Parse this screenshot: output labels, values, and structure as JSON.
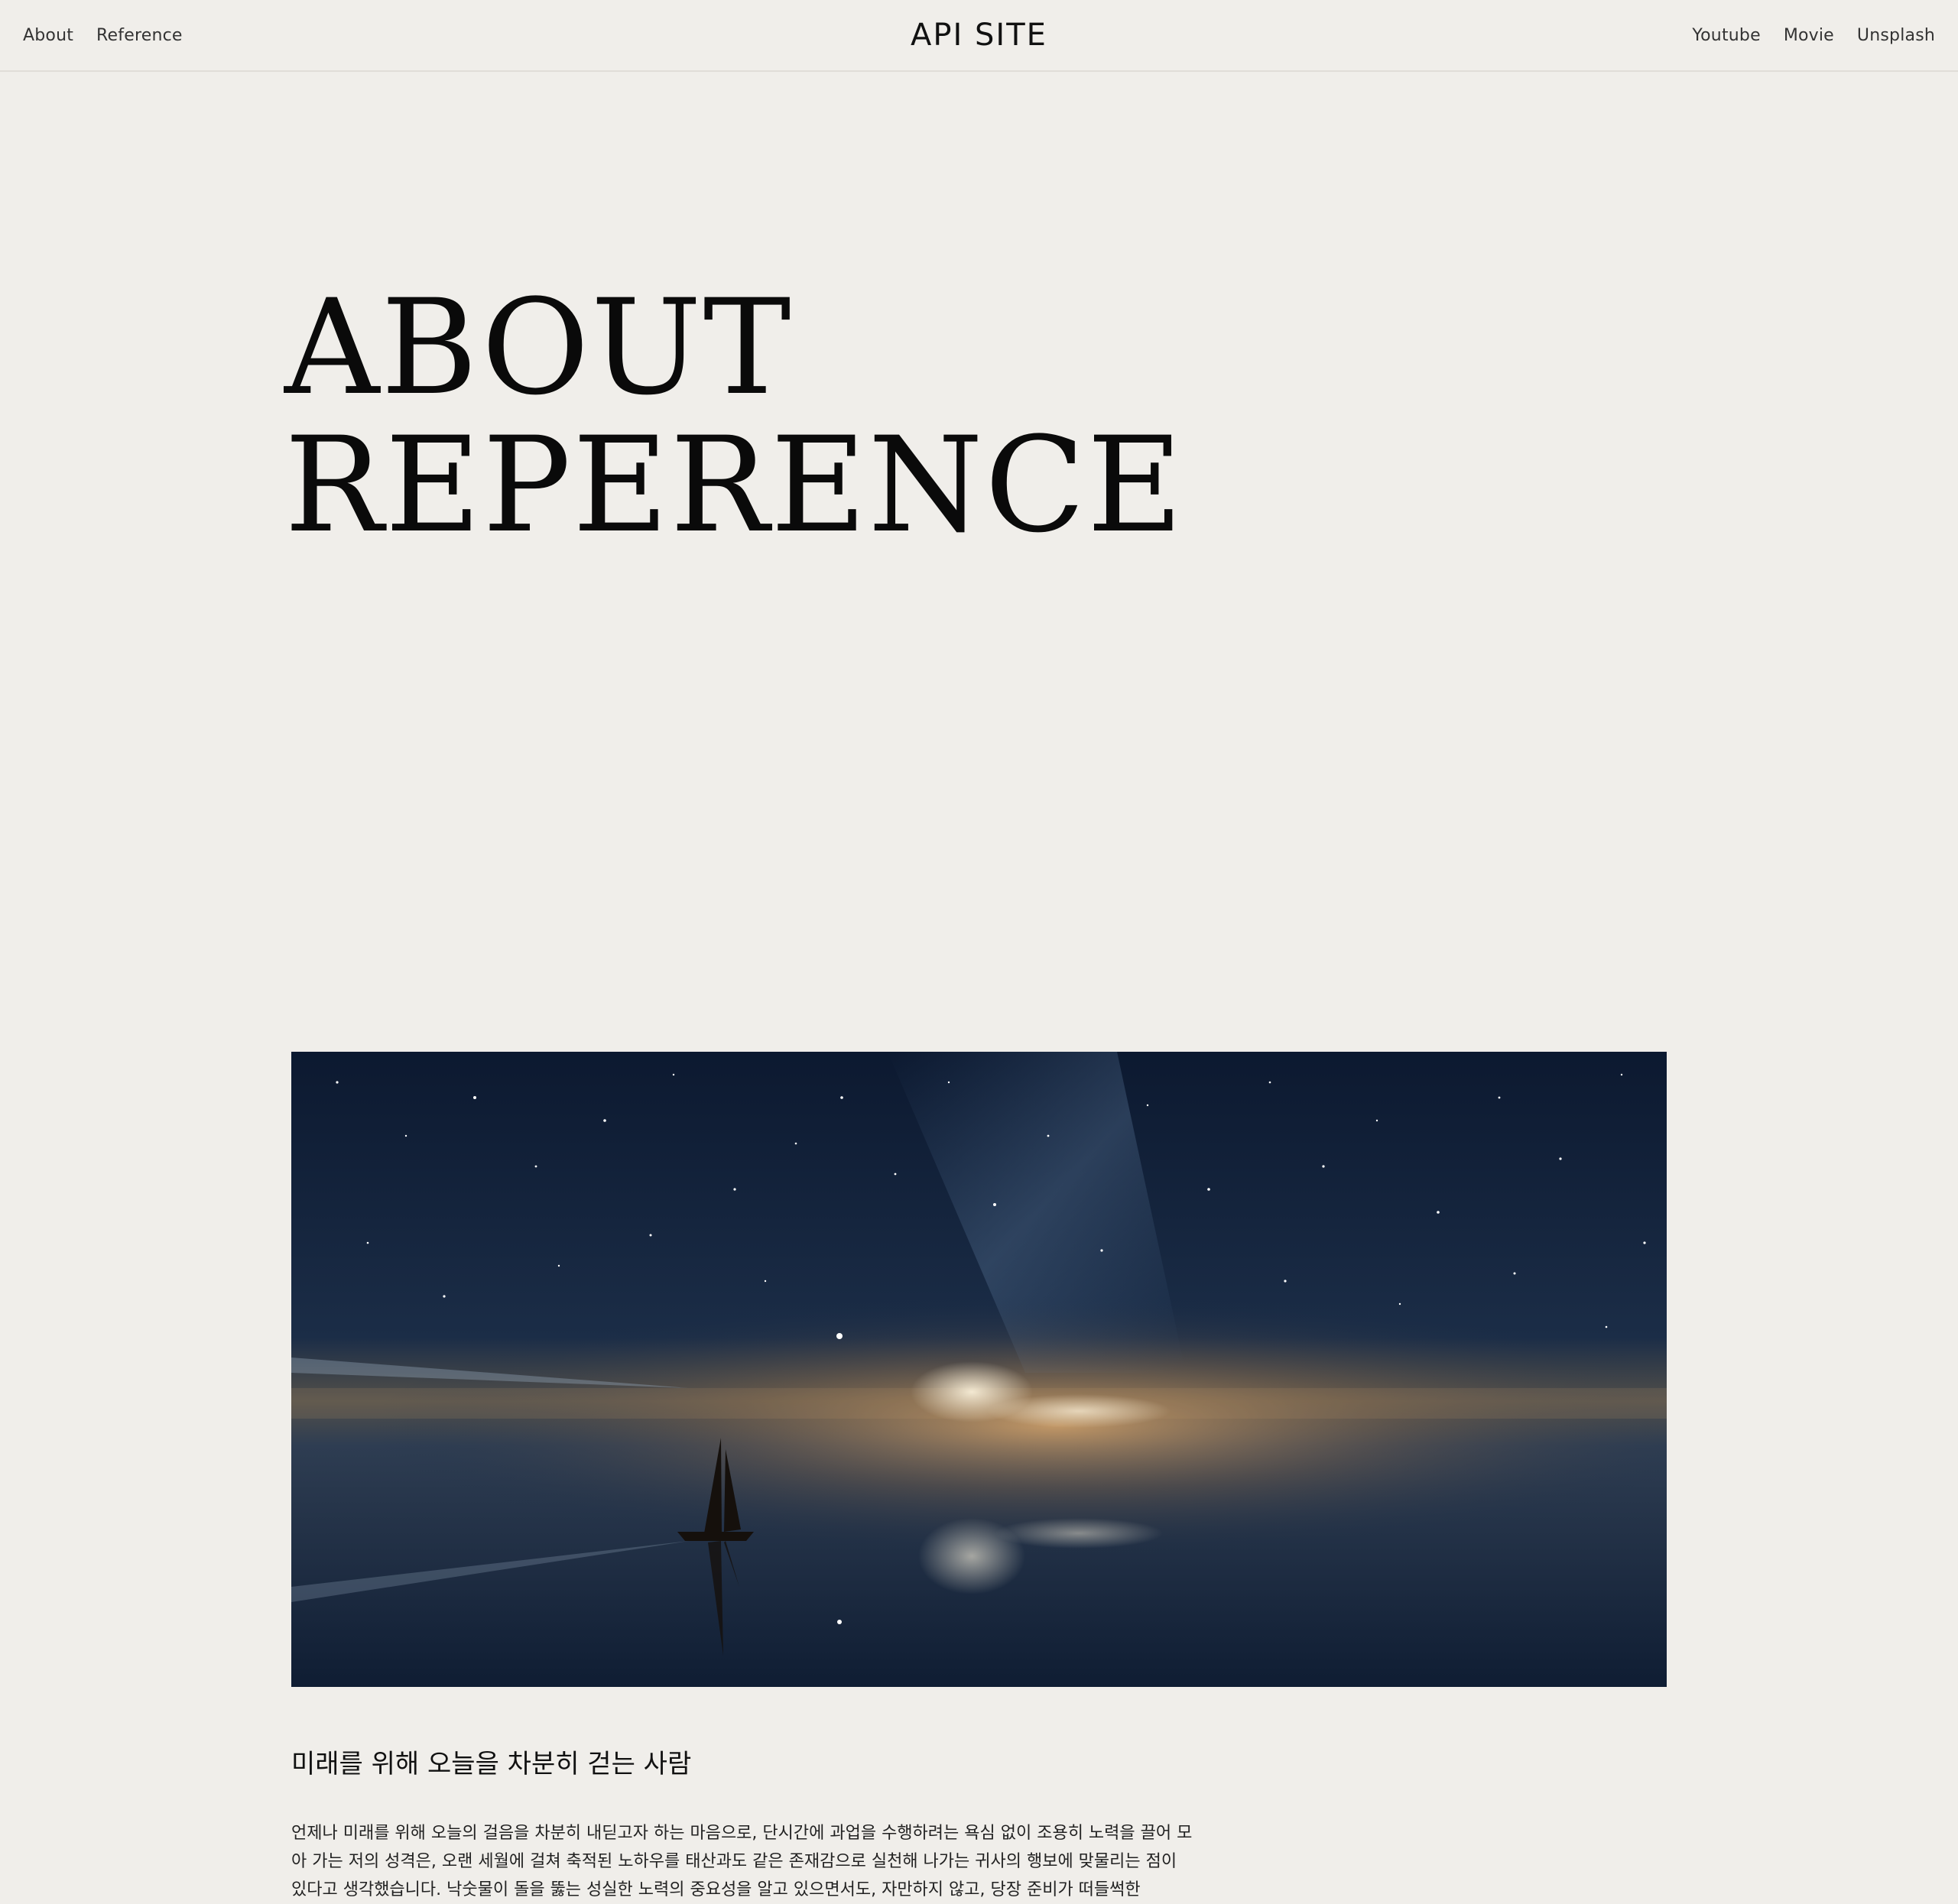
{
  "header": {
    "left_nav": [
      "About",
      "Reference"
    ],
    "site_title": "API SITE",
    "right_nav": [
      "Youtube",
      "Movie",
      "Unsplash"
    ]
  },
  "hero": {
    "title_line1": "ABOUT",
    "title_line2": "REPERENCE"
  },
  "image": {
    "subject": "sailboat on calm water under a starry night sky with the milky way and glowing clouds"
  },
  "intro": {
    "subtitle": "미래를 위해 오늘을 차분히 걷는 사람",
    "paragraph": "언제나 미래를 위해 오늘의 걸음을 차분히 내딛고자 하는 마음으로, 단시간에 과업을 수행하려는 욕심 없이 조용히 노력을 끌어 모아 가는 저의 성격은, 오랜 세월에 걸쳐 축적된 노하우를 태산과도 같은 존재감으로 실천해 나가는 귀사의 행보에 맞물리는 점이 있다고 생각했습니다. 낙숫물이 돌을 뚫는 성실한 노력의 중요성을 알고 있으면서도, 자만하지 않고, 당장 준비가 떠들썩한"
  },
  "colors": {
    "background": "#f0eeea",
    "text": "#111111",
    "border": "#e0ddd8"
  }
}
